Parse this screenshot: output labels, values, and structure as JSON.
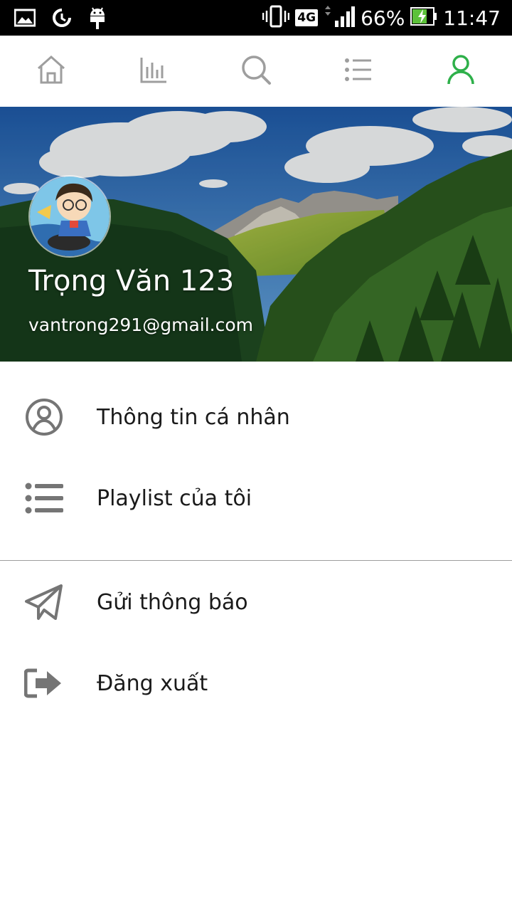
{
  "status_bar": {
    "network": "4G",
    "battery": "66%",
    "time": "11:47",
    "icons": [
      "image-icon",
      "data-saver-icon",
      "android-icon",
      "vibrate-icon",
      "signal-icon",
      "battery-charging-icon"
    ]
  },
  "tabs": [
    {
      "icon": "home-icon",
      "active": false
    },
    {
      "icon": "chart-icon",
      "active": false
    },
    {
      "icon": "search-icon",
      "active": false
    },
    {
      "icon": "list-icon",
      "active": false
    },
    {
      "icon": "user-icon",
      "active": true
    }
  ],
  "colors": {
    "active": "#2eb04a",
    "inactive": "#9e9e9e",
    "menu_icon": "#757575",
    "text": "#1a1a1a"
  },
  "profile": {
    "name": "Trọng Văn 123",
    "email": "vantrong291@gmail.com"
  },
  "menu": {
    "personal_info": "Thông tin cá nhân",
    "my_playlist": "Playlist của tôi",
    "send_notification": "Gửi thông báo",
    "logout": "Đăng xuất"
  }
}
